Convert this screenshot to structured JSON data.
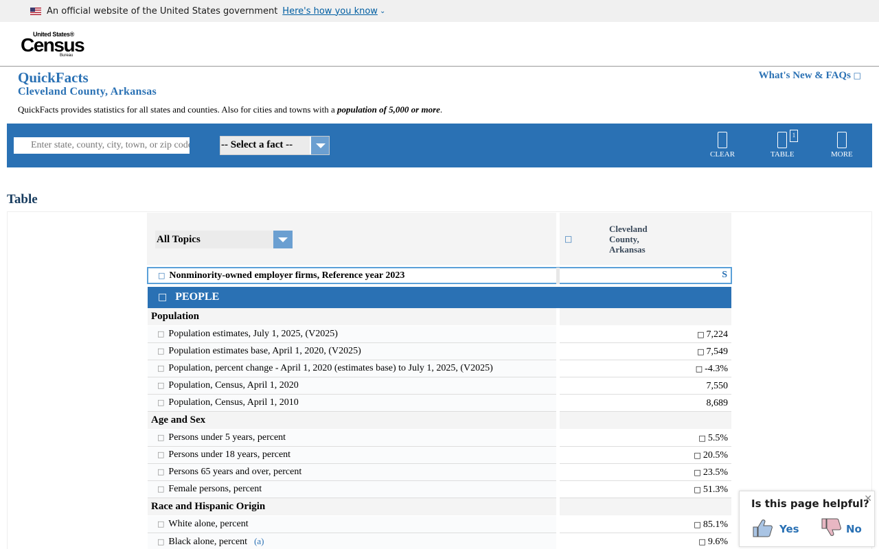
{
  "gov_banner": {
    "text": "An official website of the United States government",
    "link": "Here's how you know"
  },
  "logo": {
    "line1": "United States®",
    "line2": "Census",
    "line3": "Bureau"
  },
  "page": {
    "title": "QuickFacts",
    "subtitle": "Cleveland County, Arkansas",
    "whats_new": "What's New & FAQs",
    "description_prefix": "QuickFacts provides statistics for all states and counties. Also for cities and towns with a ",
    "description_emph": "population of 5,000 or more",
    "description_suffix": "."
  },
  "toolbar": {
    "search_placeholder": "Enter state, county, city, town, or zip code",
    "fact_select": "-- Select a fact --",
    "clear": "CLEAR",
    "table": "TABLE",
    "table_badge": "1",
    "more": "MORE"
  },
  "table": {
    "heading": "Table",
    "topics_select": "All Topics",
    "column": "Cleveland County, Arkansas",
    "selected_fact": {
      "label": "Nonminority-owned employer firms, Reference year 2023",
      "value": "S"
    },
    "section": "PEOPLE",
    "rows": [
      {
        "type": "section",
        "label": "Population",
        "value": ""
      },
      {
        "type": "row",
        "label": "Population estimates, July 1, 2025, (V2025)",
        "value": "7,224",
        "flag": true
      },
      {
        "type": "row",
        "label": "Population estimates base, April 1, 2020, (V2025)",
        "value": "7,549",
        "flag": true
      },
      {
        "type": "row",
        "label": "Population, percent change - April 1, 2020 (estimates base) to July 1, 2025, (V2025)",
        "value": "-4.3%",
        "flag": true
      },
      {
        "type": "row",
        "label": "Population, Census, April 1, 2020",
        "value": "7,550",
        "flag": false
      },
      {
        "type": "row",
        "label": "Population, Census, April 1, 2010",
        "value": "8,689",
        "flag": false
      },
      {
        "type": "section",
        "label": "Age and Sex",
        "value": ""
      },
      {
        "type": "row",
        "label": "Persons under 5 years, percent",
        "value": "5.5%",
        "flag": true
      },
      {
        "type": "row",
        "label": "Persons under 18 years, percent",
        "value": "20.5%",
        "flag": true
      },
      {
        "type": "row",
        "label": "Persons 65 years and over, percent",
        "value": "23.5%",
        "flag": true
      },
      {
        "type": "row",
        "label": "Female persons, percent",
        "value": "51.3%",
        "flag": true
      },
      {
        "type": "section",
        "label": "Race and Hispanic Origin",
        "value": ""
      },
      {
        "type": "row",
        "label": "White alone, percent",
        "value": "85.1%",
        "flag": true
      },
      {
        "type": "row",
        "label": "Black alone, percent",
        "value": "9.6%",
        "flag": true,
        "note": "(a)"
      }
    ]
  },
  "feedback": {
    "question": "Is this page helpful?",
    "yes": "Yes",
    "no": "No"
  },
  "colors": {
    "primary": "#2a71b4",
    "dark_heading": "#173b5e"
  }
}
